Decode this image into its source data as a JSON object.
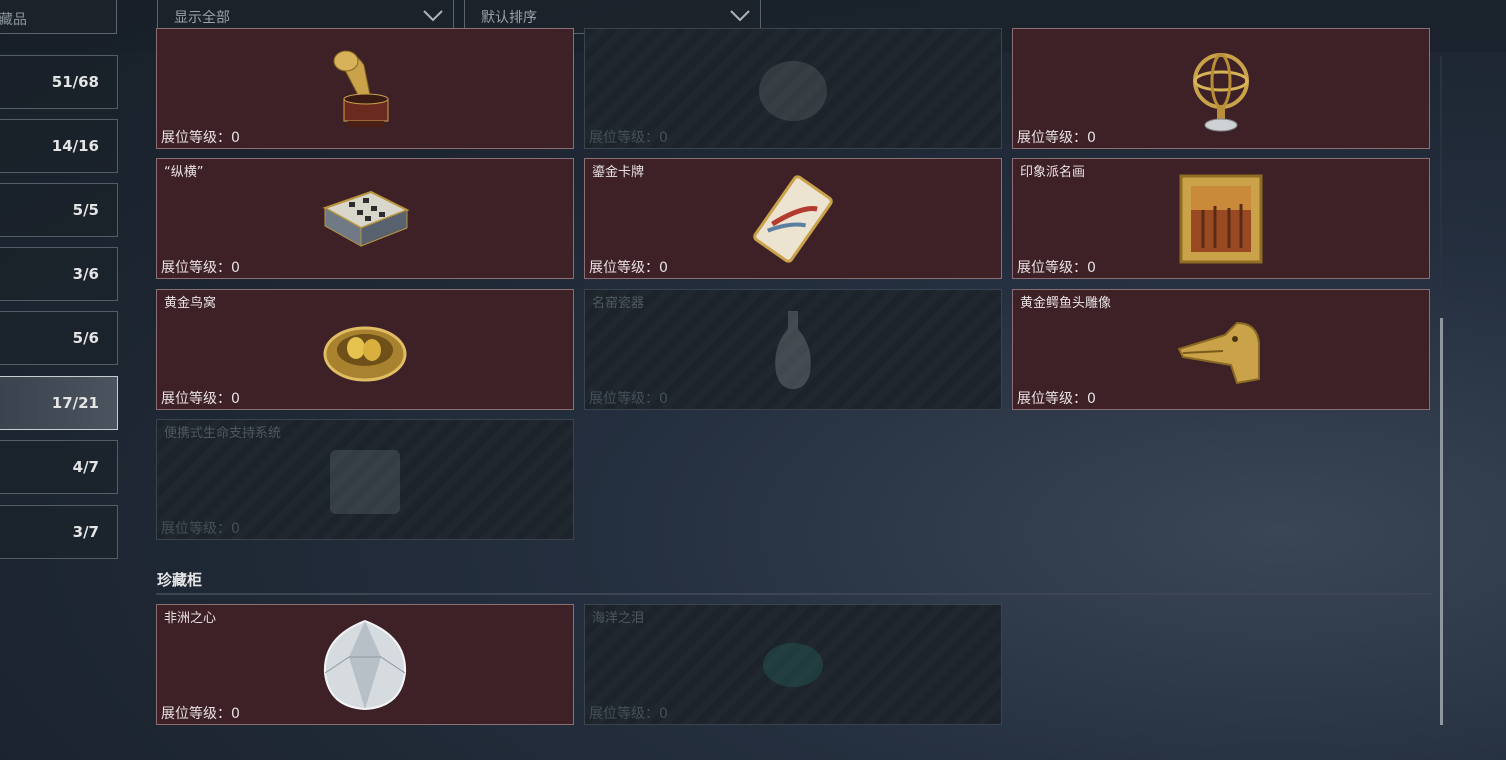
{
  "search": {
    "placeholder": "藏品"
  },
  "filters": [
    {
      "value": "显示全部"
    },
    {
      "value": "默认排序"
    }
  ],
  "sidebar": {
    "items": [
      {
        "count": "51/68"
      },
      {
        "count": "14/16"
      },
      {
        "count": "5/5"
      },
      {
        "count": "3/6"
      },
      {
        "count": "5/6"
      },
      {
        "count": "17/21"
      },
      {
        "count": "4/7"
      },
      {
        "count": "3/7"
      }
    ],
    "active_index": 5
  },
  "level_label": "展位等级：0",
  "grid": {
    "items": [
      {
        "name": "",
        "icon": "gramophone-icon",
        "unlocked": true
      },
      {
        "name": "",
        "icon": "gold-orb-icon",
        "unlocked": false
      },
      {
        "name": "",
        "icon": "armillary-sphere-icon",
        "unlocked": true
      },
      {
        "name": "“纵横”",
        "icon": "chess-box-icon",
        "unlocked": true
      },
      {
        "name": "鎏金卡牌",
        "icon": "gilded-card-icon",
        "unlocked": true
      },
      {
        "name": "印象派名画",
        "icon": "framed-painting-icon",
        "unlocked": true
      },
      {
        "name": "黄金鸟窝",
        "icon": "golden-nest-icon",
        "unlocked": true
      },
      {
        "name": "名窑瓷器",
        "icon": "porcelain-vase-icon",
        "unlocked": false
      },
      {
        "name": "黄金鳄鱼头雕像",
        "icon": "crocodile-statue-icon",
        "unlocked": true
      },
      {
        "name": "便携式生命支持系统",
        "icon": "life-support-icon",
        "unlocked": false
      }
    ]
  },
  "cabinet": {
    "title": "珍藏柜",
    "items": [
      {
        "name": "非洲之心",
        "icon": "diamond-icon",
        "unlocked": true
      },
      {
        "name": "海洋之泪",
        "icon": "ocean-tear-icon",
        "unlocked": false
      }
    ]
  },
  "colors": {
    "unlocked_card": "#3e2127",
    "locked_card": "#1e252c",
    "gold": "#c9a24a"
  }
}
